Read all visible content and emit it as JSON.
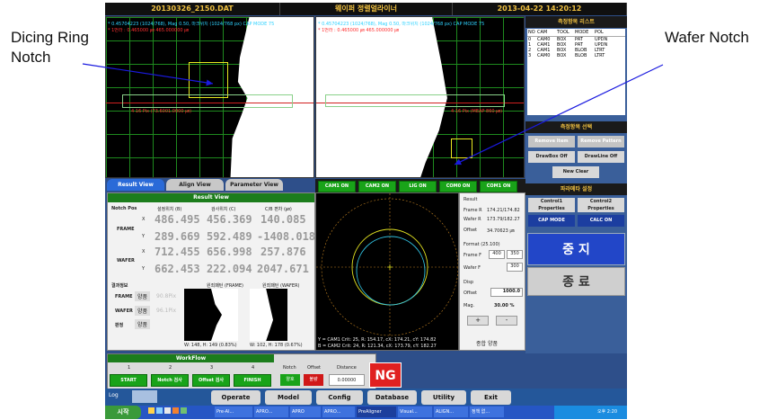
{
  "annotations": {
    "dicing_ring_notch_line1": "Dicing Ring",
    "dicing_ring_notch_line2": "Notch",
    "wafer_notch": "Wafer Notch"
  },
  "header": {
    "file": "20130326_2150.DAT",
    "app_title": "웨이퍼 정렬얼라이너",
    "datetime": "2013-04-22 14:20:12"
  },
  "camera_left": {
    "info1": "* 0.45704223 (1024/768), Mag 0.50, 마크위치 (1024/768 px)  CAP MODE 75",
    "info2": "* 1번라 : 0.465000 ㎛ 465.000000 ㎛",
    "ruler": "4 16 Pix (73.6001.0000 ㎛)"
  },
  "camera_right": {
    "info1": "* 0.45704223 (1024/768), Mag 0.50, 마크위치 (1024/768 px)  CAP MODE 75",
    "info2": "* 1번라 : 0.465000 ㎛ 465.000000 ㎛",
    "ruler": "4 16 Pix (MEAP 860 ㎛)"
  },
  "measure_list": {
    "title": "측정항목 리스트",
    "columns": [
      "NO",
      "CAM",
      "TOOL",
      "MODE",
      "POL"
    ],
    "rows": [
      [
        "0",
        "CAM0",
        "BOX",
        "PAT",
        "UPDN"
      ],
      [
        "1",
        "CAM1",
        "BOX",
        "PAT",
        "UPDN"
      ],
      [
        "2",
        "CAM1",
        "BOX",
        "BLOB",
        "LTRT"
      ],
      [
        "3",
        "CAM0",
        "BOX",
        "BLOB",
        "LTRT"
      ]
    ]
  },
  "measure_select": {
    "title": "측정항목 선택",
    "btn_remove_item": "Remove Item",
    "btn_remove_pattern": "Remove Pattern",
    "btn_drawbox_off": "DrawBox Off",
    "btn_drawline_off": "DrawLine Off",
    "btn_new_clear": "New Clear"
  },
  "param_set": {
    "title": "파라메타 설정",
    "btn_control1": "Control1 Properties",
    "btn_control2": "Control2 Properties",
    "btn_cap_mode": "CAP MODE",
    "btn_calc_on": "CALC ON"
  },
  "controls": {
    "stop": "중 지",
    "exit": "종 료"
  },
  "view_tabs": [
    "Result View",
    "Align View",
    "Parameter View"
  ],
  "cam_buttons": [
    "CAM1 ON",
    "CAM2 ON",
    "LIG ON",
    "COM0 ON",
    "COM1 ON"
  ],
  "result_view": {
    "title": "Result View",
    "notch_pos": "Notch Pos",
    "col_b": "설정위치 (B)",
    "col_c": "검사위치 (C)",
    "col_d": "C/B 편차 (㎛)",
    "frame": "FRAME",
    "wafer": "WAFER",
    "x": "X",
    "y": "Y",
    "frame_x": [
      "486.495",
      "456.369",
      "140.085"
    ],
    "frame_y": [
      "289.669",
      "592.489",
      "-1408.018"
    ],
    "wafer_x": [
      "712.455",
      "656.998",
      "257.876"
    ],
    "wafer_y": [
      "662.453",
      "222.094",
      "2047.671"
    ],
    "judge_label": "결과정보",
    "img_frame_label": "원죄패턴 (FRAME)",
    "img_wafer_label": "원죄패턴 (WAFER)",
    "frame_state": "양품",
    "wafer_state": "양품",
    "total_label": "판정",
    "total_state": "양품",
    "frame_pct": "90.8Pix",
    "wafer_pct": "96.1Pix",
    "frame_caption": "W: 148, H: 149 (0.83%)",
    "wafer_caption": "W: 102, H: 178 (0.67%)"
  },
  "plot_info": {
    "line1": "Y = CAM1 Crit: 25, R: 154.17, cX: 174.21, cY: 174.82",
    "line2": "B = CAM2 Crit: 24, R: 121.34, cX: 173.79, cY: 182.27"
  },
  "result_side": {
    "result": "Result",
    "frame_r_label": "Frame R",
    "frame_r": "174.21/174.82",
    "wafer_r_label": "Wafer R",
    "wafer_r": "173.79/182.27",
    "offset_label": "Offset",
    "offset": "34.70623 ㎛",
    "format_label": "Format (25.100)",
    "frame_f_label": "Frame F",
    "frame_f1": "400",
    "frame_f2": "350",
    "wafer_f_label": "Wafer F",
    "wafer_f": "300",
    "disp": "Disp",
    "disp_offset_label": "Offset",
    "disp_offset": "1000.0",
    "mag_label": "Mag.",
    "mag": "30.00 %",
    "plus": "+",
    "minus": "-",
    "final": "종합 양품"
  },
  "workflow": {
    "title": "WorkFlow",
    "steps": [
      "1",
      "2",
      "3",
      "4"
    ],
    "buttons": [
      "START",
      "Notch 검사",
      "Offset 검사",
      "FINISH"
    ],
    "notch_label": "Notch",
    "offset_label": "Offset",
    "distance_label": "Distance",
    "notch_state": "양호",
    "offset_state": "불량",
    "distance_value": "0.00000",
    "result": "NG"
  },
  "bottom_nav": {
    "log": "Log",
    "operate": "Operate",
    "model": "Model",
    "config": "Config",
    "database": "Database",
    "utility": "Utility",
    "exit": "Exit"
  },
  "taskbar": {
    "start": "시작",
    "items": [
      "Pre-Al...",
      "APRO...",
      "APRO",
      "APRO...",
      "PreAligner",
      "Visual...",
      "ALIGN...",
      "정책 없..."
    ],
    "clock": "오후 2:20"
  }
}
